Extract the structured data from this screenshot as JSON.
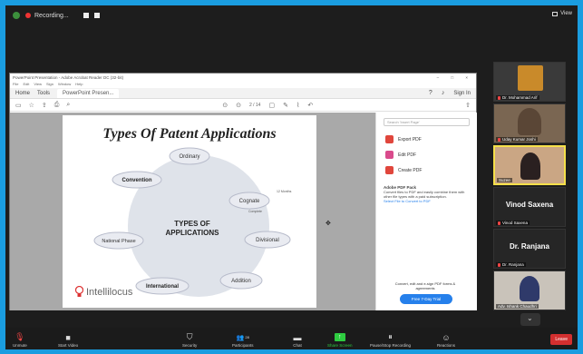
{
  "topbar": {
    "recording_label": "Recording...",
    "view_label": "View"
  },
  "viewer": {
    "window_title": "PowerPoint Presentation - Adobe Acrobat Reader DC (32-bit)",
    "menu": [
      "File",
      "Edit",
      "View",
      "Sign",
      "Window",
      "Help"
    ],
    "tabs": [
      "Home",
      "Tools",
      "PowerPoint Presen..."
    ],
    "sign_in": "Sign In",
    "page_current": "2",
    "page_total": "/ 14",
    "right_pane": {
      "search_placeholder": "Search 'Insert Page'",
      "tools": [
        {
          "label": "Export PDF",
          "color": "#e0463c"
        },
        {
          "label": "Edit PDF",
          "color": "#d94b8c"
        },
        {
          "label": "Create PDF",
          "color": "#e0463c"
        }
      ],
      "promo_title": "Adobe PDF Pack",
      "promo_text": "Convert files to PDF and easily combine them with other file types with a paid subscription.",
      "promo_link": "Select File to Convert to PDF",
      "free_text": "Convert, edit and e-sign PDF forms & agreements",
      "trial_button": "Free 7-Day Trial"
    }
  },
  "slide": {
    "title": "Types Of Patent Applications",
    "center_label_1": "TYPES OF",
    "center_label_2": "APPLICATIONS",
    "nodes": {
      "ordinary": "Ordinary",
      "convention": "Convention",
      "cognate": "Cognate",
      "divisional": "Divisional",
      "national_phase": "National Phase",
      "international": "International",
      "addition": "Addition"
    },
    "cognate_note_1": "12 Months",
    "cognate_note_2": "Complete",
    "logo_text": "Intellilocus"
  },
  "participants": {
    "p1": "Dr. Mohammad Arif",
    "p2": "Uday Kumar Joshi",
    "p3": "Suzee",
    "p4": "Vinod Saxena",
    "p4_small": "Vinod Saxena",
    "p5": "Dr. Ranjana",
    "p5_small": "Dr. Ranjana",
    "p6": "Adv. Ishank Chaudhri"
  },
  "bottombar": {
    "unmute": "Unmute",
    "start_video": "Start Video",
    "security": "Security",
    "participants": "Participants",
    "participants_count": "28",
    "chat": "Chat",
    "share_screen": "Share Screen",
    "pause_recording": "Pause/Stop Recording",
    "reactions": "Reactions",
    "leave": "Leave"
  },
  "colors": {
    "accent_blue": "#1a9de0",
    "share_green": "#2ecc40",
    "leave_red": "#d32f2f",
    "active_speaker": "#f5e04a"
  }
}
